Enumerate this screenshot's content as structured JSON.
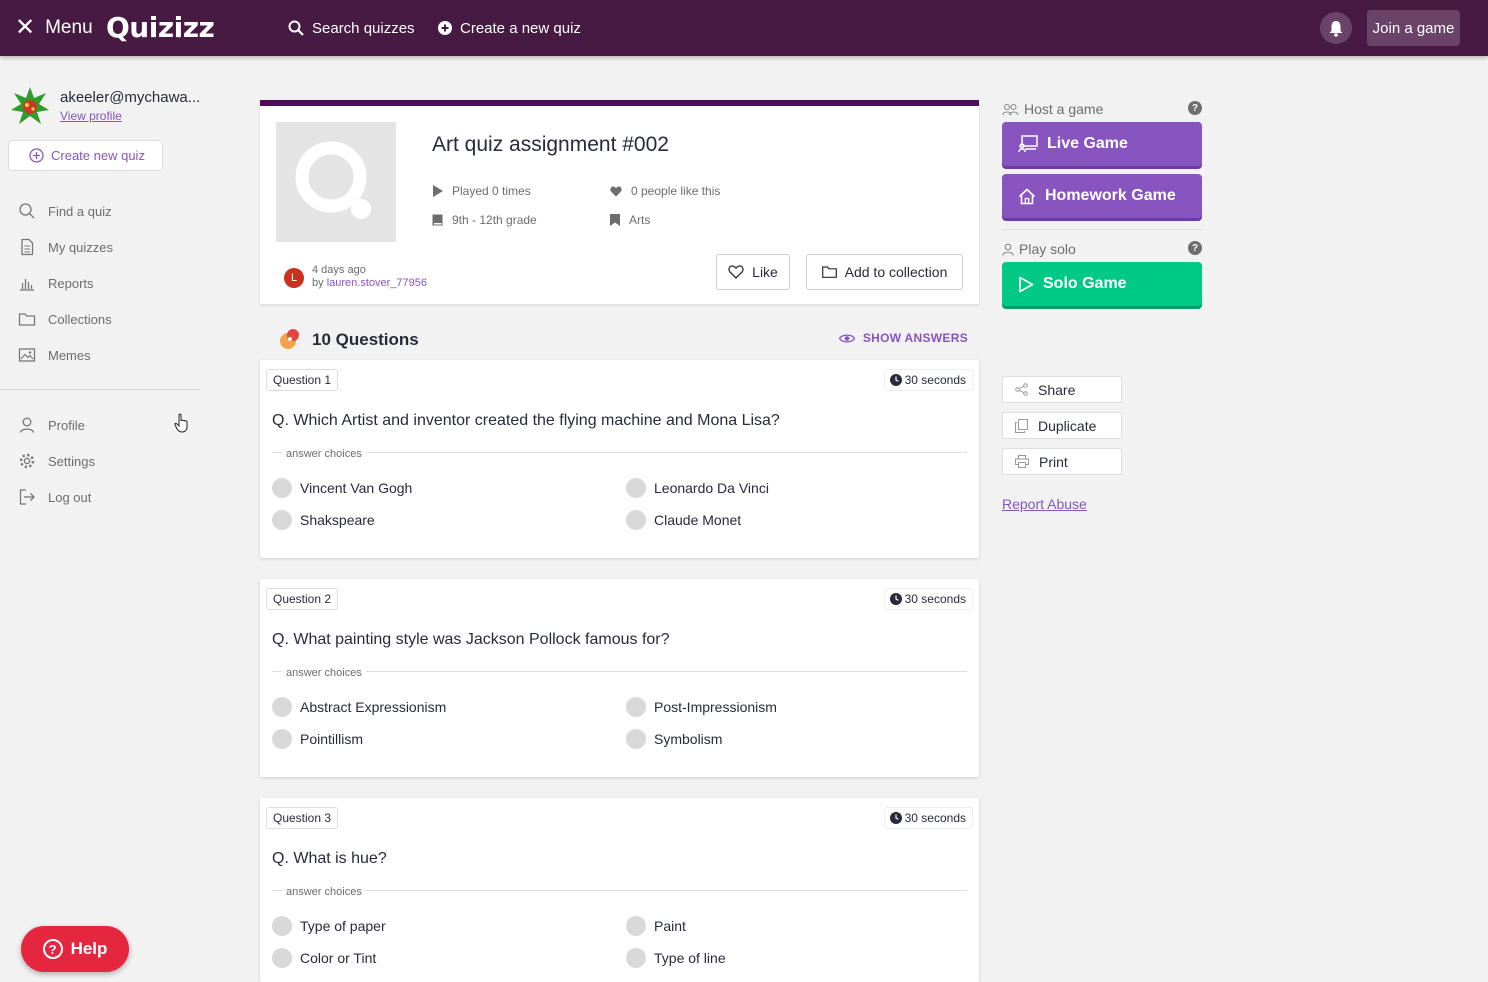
{
  "header": {
    "menu_label": "Menu",
    "logo_text": "Quizizz",
    "search_label": "Search quizzes",
    "create_label": "Create a new quiz",
    "join_label": "Join a game"
  },
  "sidebar": {
    "username": "akeeler@mychawa...",
    "view_profile": "View profile",
    "create_new_quiz": "Create new quiz",
    "nav": [
      {
        "label": "Find a quiz",
        "icon": "search-icon"
      },
      {
        "label": "My quizzes",
        "icon": "document-icon"
      },
      {
        "label": "Reports",
        "icon": "bar-chart-icon"
      },
      {
        "label": "Collections",
        "icon": "folder-icon"
      },
      {
        "label": "Memes",
        "icon": "image-icon"
      }
    ],
    "account": [
      {
        "label": "Profile",
        "icon": "user-icon"
      },
      {
        "label": "Settings",
        "icon": "gear-icon"
      },
      {
        "label": "Log out",
        "icon": "logout-icon"
      }
    ],
    "help_label": "Help"
  },
  "quiz": {
    "title": "Art quiz assignment #002",
    "played": "Played 0 times",
    "likes": "0 people like this",
    "grade": "9th - 12th grade",
    "subject": "Arts",
    "time_ago": "4 days ago",
    "by_prefix": "by",
    "author": "lauren.stover_77956",
    "author_initial": "L",
    "like_label": "Like",
    "add_collection_label": "Add to collection"
  },
  "questions_header": {
    "count_label": "10 Questions",
    "show_answers": "SHOW ANSWERS"
  },
  "questions": [
    {
      "label": "Question 1",
      "time": "30 seconds",
      "text": "Q. Which Artist and inventor created the flying machine and Mona Lisa?",
      "answer_choices_label": "answer choices",
      "options": [
        "Vincent Van Gogh",
        "Leonardo Da Vinci",
        "Shakspeare",
        "Claude Monet"
      ]
    },
    {
      "label": "Question 2",
      "time": "30 seconds",
      "text": "Q. What painting style was Jackson Pollock famous for?",
      "answer_choices_label": "answer choices",
      "options": [
        "Abstract Expressionism",
        "Post-Impressionism",
        "Pointillism",
        "Symbolism"
      ]
    },
    {
      "label": "Question 3",
      "time": "30 seconds",
      "text": "Q. What is hue?",
      "answer_choices_label": "answer choices",
      "options": [
        "Type of paper",
        "Paint",
        "Color or Tint",
        "Type of line"
      ]
    }
  ],
  "right_panel": {
    "host_label": "Host a game",
    "live_game": "Live Game",
    "homework_game": "Homework Game",
    "play_solo_label": "Play solo",
    "solo_game": "Solo Game",
    "share": "Share",
    "duplicate": "Duplicate",
    "print": "Print",
    "report_abuse": "Report Abuse",
    "help_glyph": "?"
  },
  "colors": {
    "topbar": "#461a42",
    "accent_purple": "#8854c0",
    "solo_green": "#00c985",
    "help_red": "#e5263f"
  }
}
